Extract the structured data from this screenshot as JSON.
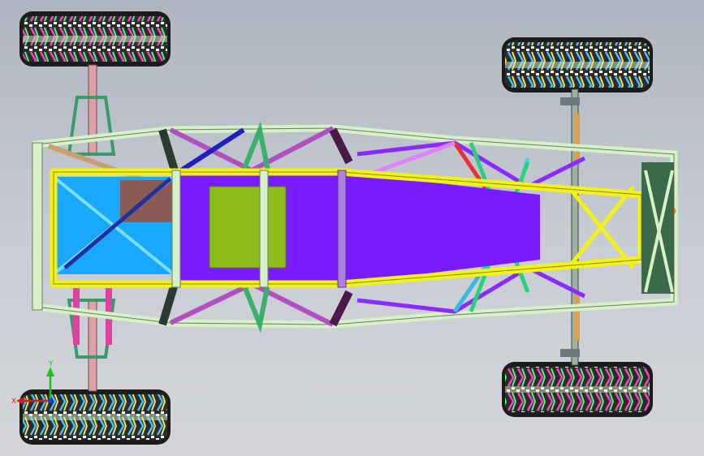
{
  "viewport": {
    "background_top": "#aeb5c0",
    "background_bottom": "#d3d5d8"
  },
  "triad": {
    "y_label": "Y",
    "x_label": "X",
    "y_color": "#19c419",
    "x_color": "#e01818"
  },
  "colors": {
    "frame_outer": "#d6f0c8",
    "frame_outline": "#7a8a70",
    "main_rail": "#f2f21a",
    "floor_panel": "#7a1aff",
    "seat_pad": "#8dbd1a",
    "front_box": "#1aa8ff",
    "battery": "#8a5a55",
    "tire_tread": "#3a3a3a",
    "hub_axle": "#c89aa0"
  },
  "icons": [
    "tire-icon",
    "coordinate-triad-icon"
  ]
}
